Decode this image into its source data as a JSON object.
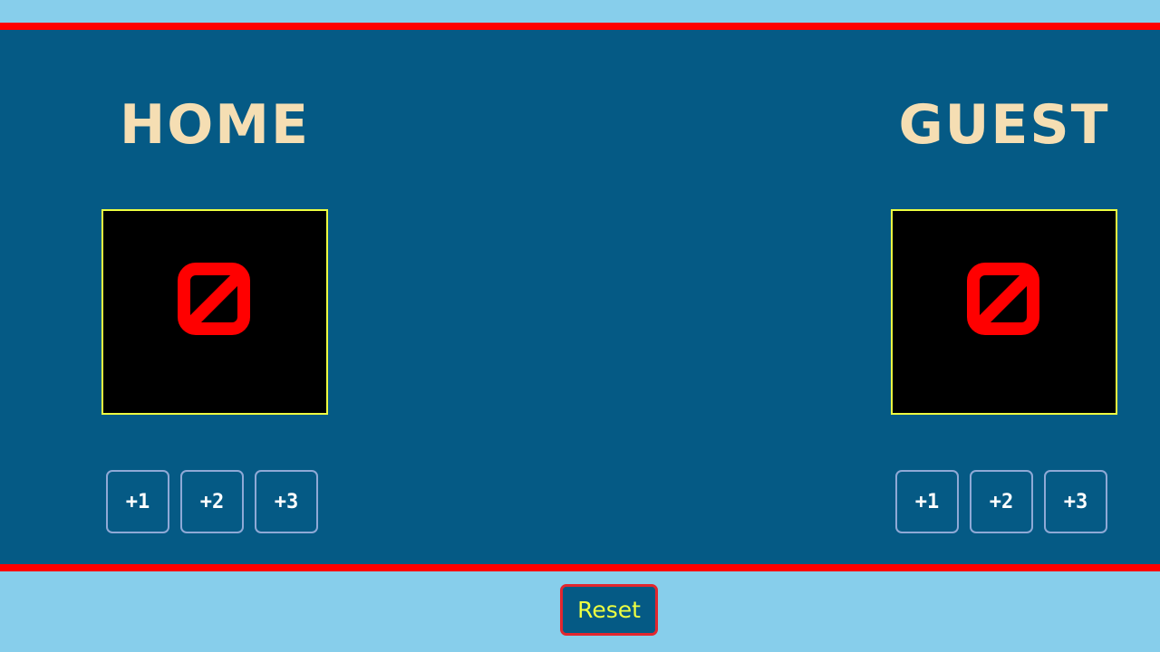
{
  "colors": {
    "page_background": "#87CEEB",
    "board_background": "#055A85",
    "border_red": "#FF0000",
    "team_name": "#F5DEB3",
    "score_box_border": "#EEFF41",
    "score_digit": "#FF0000",
    "button_border": "#8FA9D6",
    "reset_text": "#EEFF41"
  },
  "home": {
    "name": "HOME",
    "score": 0,
    "buttons": [
      "+1",
      "+2",
      "+3"
    ]
  },
  "guest": {
    "name": "GUEST",
    "score": 0,
    "buttons": [
      "+1",
      "+2",
      "+3"
    ]
  },
  "reset": {
    "label": "Reset"
  }
}
